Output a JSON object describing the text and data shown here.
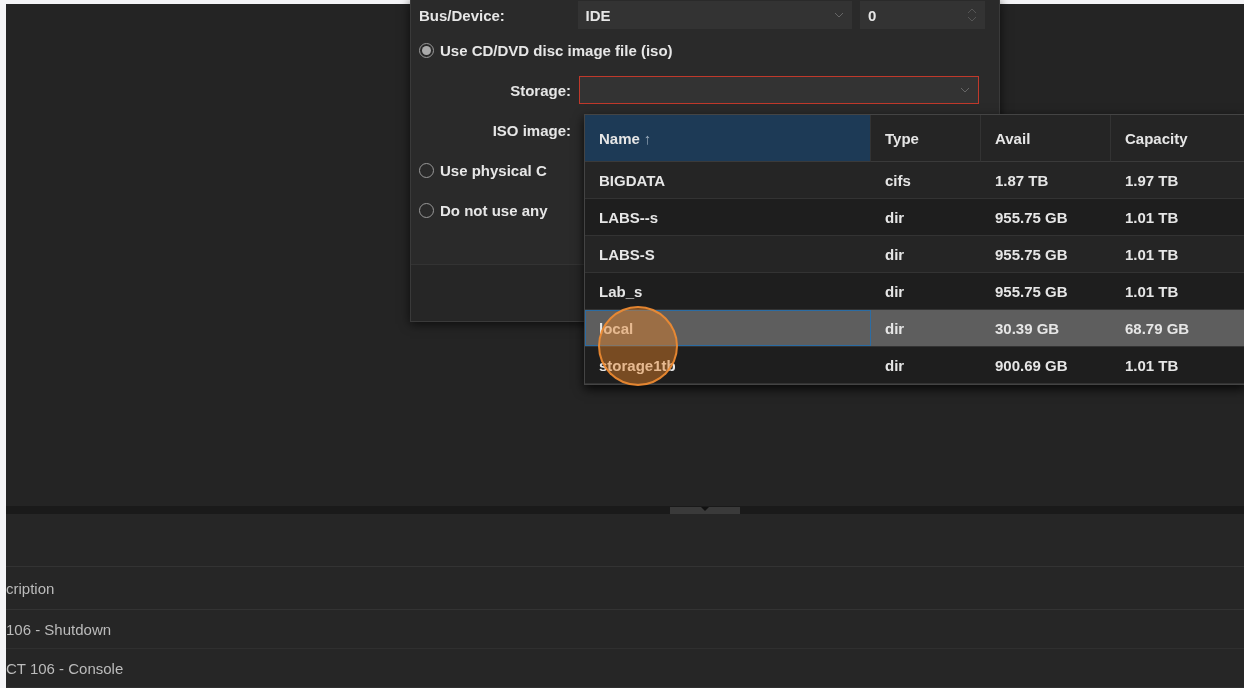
{
  "dialog": {
    "bus_device": {
      "label": "Bus/Device:",
      "bus": "IDE",
      "device": "0"
    },
    "options": [
      {
        "label": "Use CD/DVD disc image file (iso)",
        "selected": true
      },
      {
        "label": "Use physical C",
        "selected": false
      },
      {
        "label": "Do not use any",
        "selected": false
      }
    ],
    "storage": {
      "label": "Storage:",
      "invalid": true
    },
    "iso_image": {
      "label": "ISO image:"
    }
  },
  "storage_picker": {
    "columns": [
      {
        "label": "Name",
        "sort": "↑",
        "selected": true
      },
      {
        "label": "Type",
        "selected": false
      },
      {
        "label": "Avail",
        "selected": false
      },
      {
        "label": "Capacity",
        "selected": false
      }
    ],
    "rows": [
      {
        "name": "BIGDATA",
        "type": "cifs",
        "avail": "1.87 TB",
        "capacity": "1.97 TB",
        "selected": false
      },
      {
        "name": "LABS--s",
        "type": "dir",
        "avail": "955.75 GB",
        "capacity": "1.01 TB",
        "selected": false
      },
      {
        "name": "LABS-S",
        "type": "dir",
        "avail": "955.75 GB",
        "capacity": "1.01 TB",
        "selected": false
      },
      {
        "name": "Lab_s",
        "type": "dir",
        "avail": "955.75 GB",
        "capacity": "1.01 TB",
        "selected": false
      },
      {
        "name": "local",
        "type": "dir",
        "avail": "30.39 GB",
        "capacity": "68.79 GB",
        "selected": true
      },
      {
        "name": "storage1tb",
        "type": "dir",
        "avail": "900.69 GB",
        "capacity": "1.01 TB",
        "selected": false
      }
    ]
  },
  "log_panel": {
    "header": "cription",
    "rows": [
      "106 - Shutdown",
      "CT 106 - Console"
    ]
  }
}
